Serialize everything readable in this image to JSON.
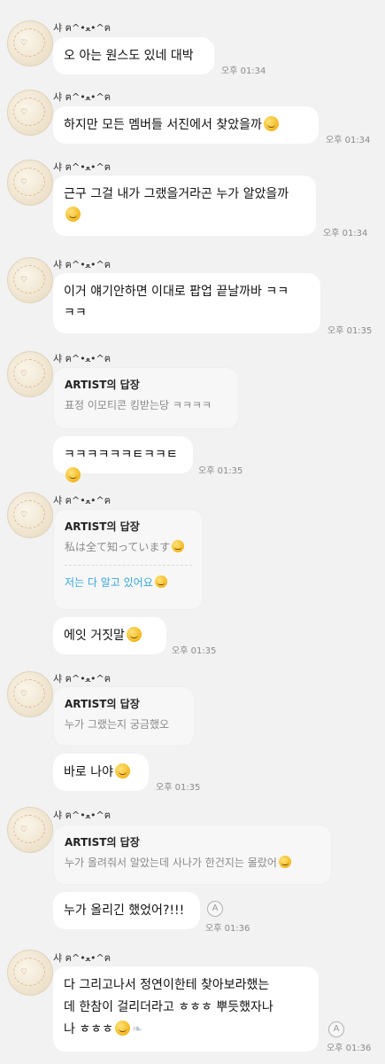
{
  "sender_name": "샤 ฅ^•ﻌ•^ฅ",
  "messages": [
    {
      "text": "오 아는 원스도 있네 대박",
      "time": "오후 01:34"
    },
    {
      "text": "하지만 모든 멤버들 서진에서 찾았을까",
      "time": "오후 01:34"
    },
    {
      "text_line1": "근구 그걸 내가 그랬을거라곤 누가 알았을까",
      "time": "오후 01:34"
    },
    {
      "text_line1": "이거 얘기안하면 이대로 팝업 끝날까바 ㅋㅋ",
      "text_line2": "ㅋㅋ",
      "time": "오후 01:35"
    },
    {
      "reply_title": "ARTIST의 답장",
      "reply_text": "표정 이모티콘 킹받는당 ㅋㅋㅋㅋ",
      "text": "ㅋㅋㅋㅋㅋㅋㅌㅋㅋㅌ",
      "time": "오후 01:35"
    },
    {
      "reply_title": "ARTIST의 답장",
      "reply_text": "私は全て知っています",
      "reply_translation": "저는 다 알고 있어요",
      "text": "에잇 거짓말",
      "time": "오후 01:35"
    },
    {
      "reply_title": "ARTIST의 답장",
      "reply_text": "누가 그랬는지 궁금했오",
      "text": "바로 나야",
      "time": "오후 01:35"
    },
    {
      "reply_title": "ARTIST의 답장",
      "reply_text": "누가 올려줘서 알았는데 사나가 한건지는 몰랐어",
      "text": "누가 올리긴 했었어?!!!",
      "time": "오후 01:36",
      "icon": "A"
    },
    {
      "text_line1": "다 그리고나서 정연이한테 찾아보라했는",
      "text_line2": "데 한참이 걸리더라고 ㅎㅎㅎ 뿌듯했자나",
      "text_line3": "나 ㅎㅎㅎ",
      "time": "오후 01:36",
      "icon": "A"
    }
  ],
  "avatar_doodle": "♡",
  "colors": {
    "background": "#f2f2f2",
    "bubble": "#ffffff",
    "reply_bg": "#f7f7f7",
    "translation": "#37a6d8"
  }
}
